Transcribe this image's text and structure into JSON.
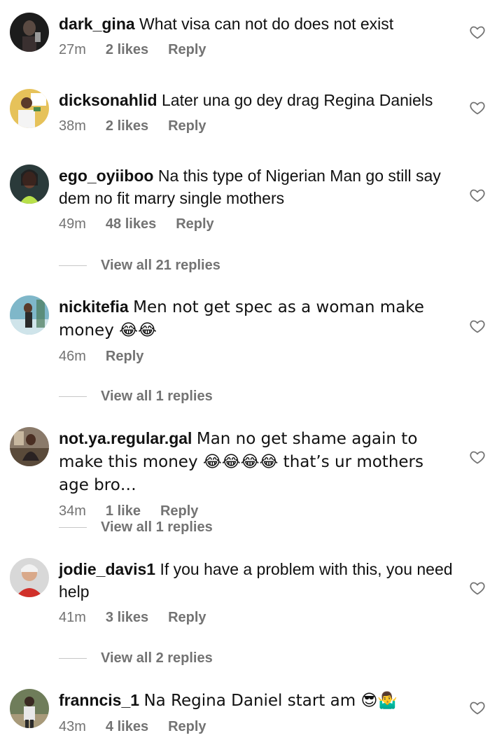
{
  "comments": [
    {
      "username": "dark_gina",
      "text": "What visa can not do does not exist",
      "time": "27m",
      "likes": "2 likes",
      "reply": "Reply",
      "avatar_icon": "avatar-dark-photo",
      "avatar_color": "#1c1c1c"
    },
    {
      "username": "dicksonahlid",
      "text": "Later una go dey drag Regina Daniels",
      "time": "38m",
      "likes": "2 likes",
      "reply": "Reply",
      "avatar_icon": "avatar-man-yellow",
      "avatar_color": "#e6c25a"
    },
    {
      "username": "ego_oyiiboo",
      "text": "Na this type of Nigerian Man go still say dem no fit marry single mothers",
      "time": "49m",
      "likes": "48 likes",
      "reply": "Reply",
      "avatar_icon": "avatar-woman-green",
      "avatar_color": "#2a3a3a",
      "view_replies": "View all 21 replies"
    },
    {
      "username": "nickitefia",
      "text": "Men not get spec as a woman make money 😂😂",
      "time": "46m",
      "likes": "",
      "reply": "Reply",
      "avatar_icon": "avatar-woman-pool",
      "avatar_color": "#7fb7c9",
      "view_replies": "View all 1 replies"
    },
    {
      "username": "not.ya.regular.gal",
      "text": "Man no get shame again to make this money 😂😂😂😂 that’s ur mothers age bro…",
      "time": "34m",
      "likes": "1 like",
      "reply": "Reply",
      "avatar_icon": "avatar-woman-seated",
      "avatar_color": "#8a7a6a",
      "view_replies": "View all 1 replies"
    },
    {
      "username": "jodie_davis1",
      "text": "If you have a problem with this, you need help",
      "time": "41m",
      "likes": "3 likes",
      "reply": "Reply",
      "avatar_icon": "avatar-person-red",
      "avatar_color": "#d8d8d8",
      "view_replies": "View all 2 replies"
    },
    {
      "username": "franncis_1",
      "text": "Na Regina Daniel start am 😎🤷‍♂️",
      "time": "43m",
      "likes": "4 likes",
      "reply": "Reply",
      "avatar_icon": "avatar-man-outdoor",
      "avatar_color": "#6f7d5a"
    }
  ],
  "colors": {
    "secondary_text": "#737373",
    "primary_text": "#111111",
    "heart_stroke": "#737373"
  },
  "icons": {
    "like": "heart-outline-icon"
  }
}
